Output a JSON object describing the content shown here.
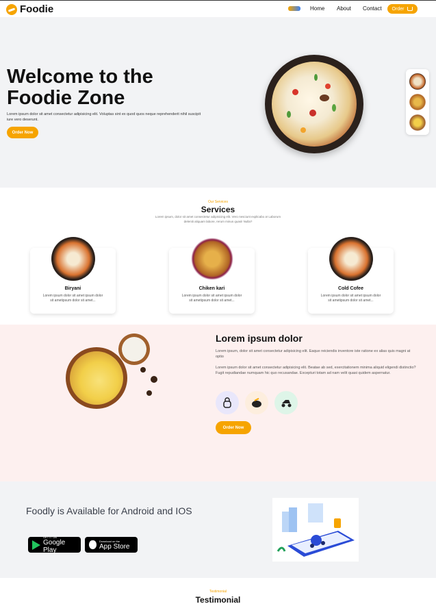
{
  "nav": {
    "logo": "Foodie",
    "links": [
      "Home",
      "About",
      "Contact"
    ],
    "order_label": "Order"
  },
  "hero": {
    "title": "Welcome to the Foodie Zone",
    "text": "Lorem ipsum dolor sit amet consectetur adipisicing elit. Voluptas sint ex quod quos neque reprehenderit nihil suscipit iure vero deserunt.",
    "button": "Order Now"
  },
  "services": {
    "kicker": "Our Services",
    "title": "Services",
    "subtitle": "Lorem ipsum, dolor sit amet consectetur adipisicing elit. Vero nesciunt explicabo a! Laborum deleniti aliquam labore, rerum minus quasi! Nulla?",
    "cards": [
      {
        "title": "Biryani",
        "text": "Lorem ipsum dolor sit amet ipsum dolor sit ametipsum dolor sit amet..."
      },
      {
        "title": "Chiken kari",
        "text": "Lorem ipsum dolor sit amet ipsum dolor sit ametipsum dolor sit amet..."
      },
      {
        "title": "Cold Cofee",
        "text": "Lorem ipsum dolor sit amet ipsum dolor sit ametipsum dolor sit amet..."
      }
    ]
  },
  "about": {
    "title": "Lorem ipsum dolor",
    "para1": "Lorem ipsum, dolor sit amet consectetur adipisicing elit. Eaque reiciendis inventore iste ratione ex alias quis magni at optio",
    "para2": "Lorem ipsum dolor sit amet consectetur adipisicing elit. Beatae ab sed, exercitationem minima aliquid eligendi distinctio? Fugit repudiandae numquam hic quo recusandae. Excepturi totam ad nam velit quasi quidem aspernatur.",
    "button": "Order Now"
  },
  "app": {
    "title": "Foodly is Available for Android and IOS",
    "google_small": "GET IT ON",
    "google_big": "Google Play",
    "apple_small": "Download on the",
    "apple_big": "App Store"
  },
  "testimonial": {
    "kicker": "Testimonial",
    "title": "Testimonial"
  },
  "colors": {
    "accent": "#f6a400",
    "hero_bg": "#f2f3f5",
    "about_bg": "#fdf0ef"
  }
}
